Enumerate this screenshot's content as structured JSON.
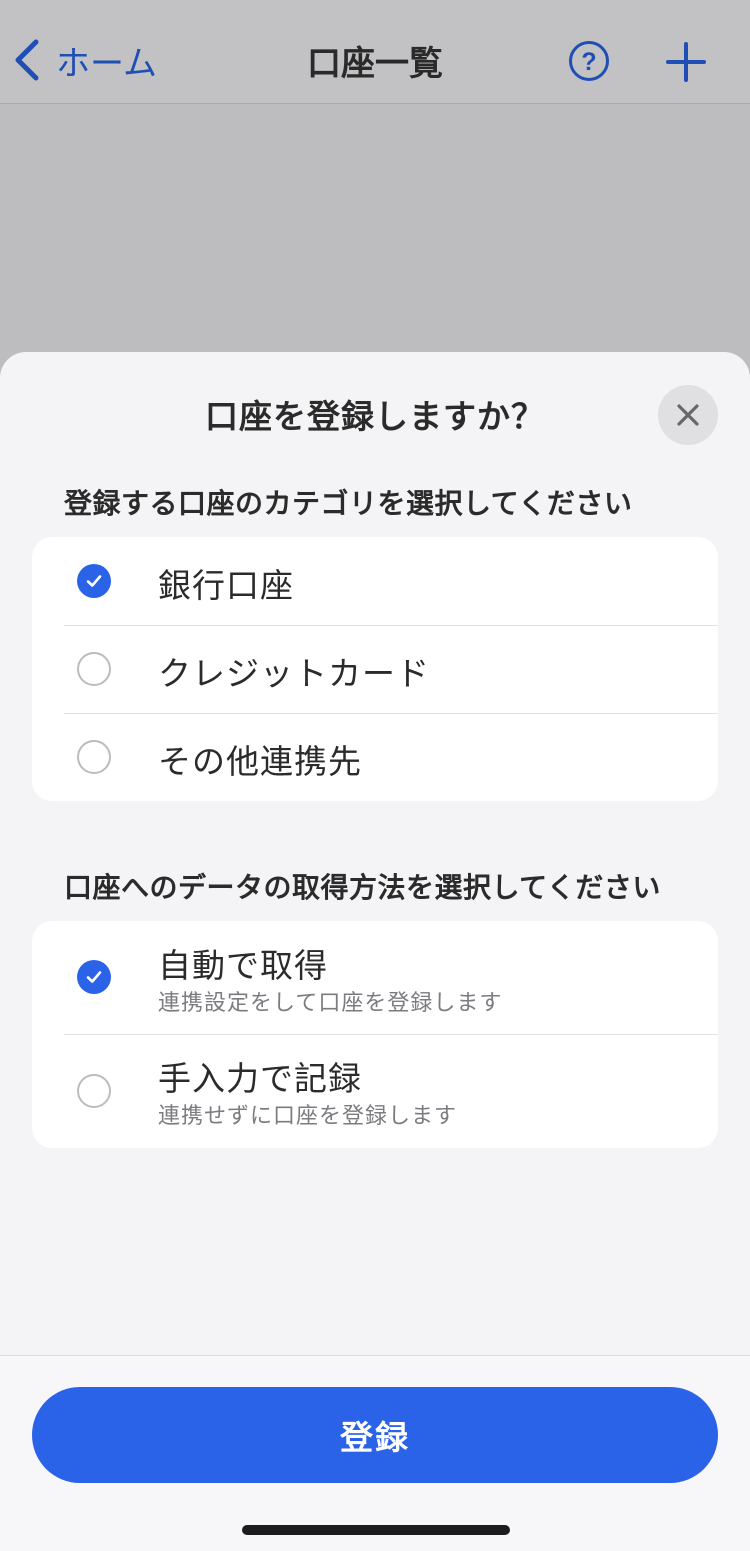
{
  "nav": {
    "back_label": "ホーム",
    "title": "口座一覧",
    "help_icon": "question-circle-icon",
    "add_icon": "plus-icon"
  },
  "sheet": {
    "title": "口座を登録しますか？",
    "close_icon": "close-icon",
    "category_section": {
      "label": "登録する口座のカテゴリを選択してください",
      "options": [
        {
          "label": "銀行口座",
          "selected": true
        },
        {
          "label": "クレジットカード",
          "selected": false
        },
        {
          "label": "その他連携先",
          "selected": false
        }
      ]
    },
    "method_section": {
      "label": "口座へのデータの取得方法を選択してください",
      "options": [
        {
          "label": "自動で取得",
          "description": "連携設定をして口座を登録します",
          "selected": true
        },
        {
          "label": "手入力で記録",
          "description": "連携せずに口座を登録します",
          "selected": false
        }
      ]
    },
    "submit_label": "登録"
  },
  "colors": {
    "accent": "#2b63e8",
    "nav_link": "#1f4fb5",
    "overlay": "#bdbcbe",
    "sheet_bg": "#f4f3f5"
  }
}
